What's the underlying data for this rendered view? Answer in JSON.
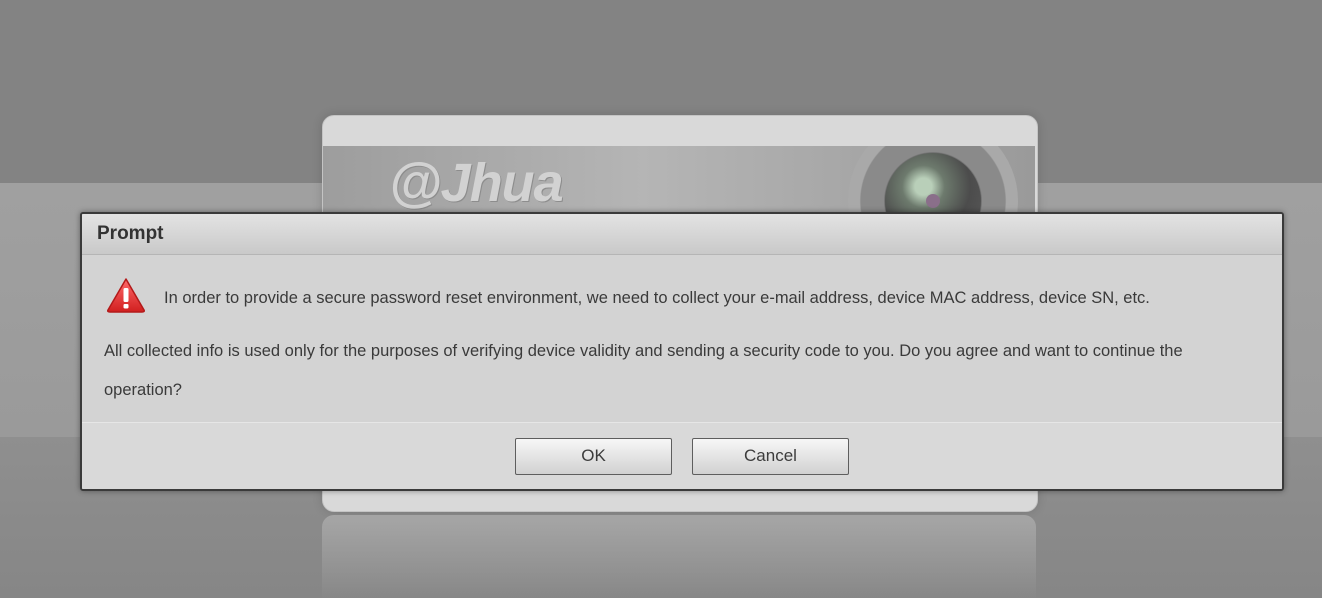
{
  "background": {
    "brand_logo": "alhua"
  },
  "dialog": {
    "title": "Prompt",
    "icon": "warning-icon",
    "message_line1": "In order to provide a secure password reset environment, we need to collect your e-mail address, device MAC address, device SN, etc.",
    "message_line2": "All collected info is used only for the purposes of verifying device validity and sending a security code to you. Do you agree and want to continue the operation?",
    "ok_label": "OK",
    "cancel_label": "Cancel"
  },
  "colors": {
    "warning_red": "#e33b3b",
    "dialog_border": "#3a3a3a"
  }
}
